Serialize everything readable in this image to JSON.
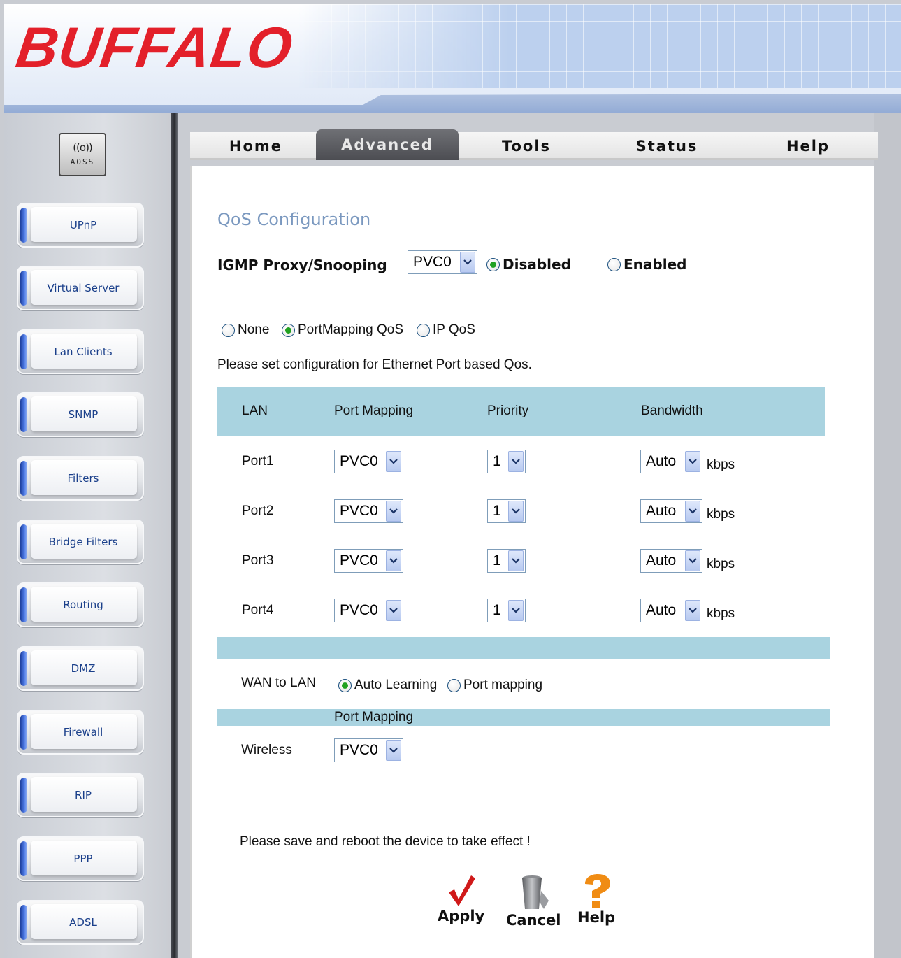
{
  "brand": {
    "logo_text": "BUFFALO",
    "logo_color": "#e3202a",
    "aoss_label": "AOSS"
  },
  "tabs": [
    {
      "label": "Home",
      "active": false
    },
    {
      "label": "Advanced",
      "active": true
    },
    {
      "label": "Tools",
      "active": false
    },
    {
      "label": "Status",
      "active": false
    },
    {
      "label": "Help",
      "active": false
    }
  ],
  "sidebar": {
    "items": [
      {
        "label": "UPnP"
      },
      {
        "label": "Virtual Server"
      },
      {
        "label": "Lan Clients"
      },
      {
        "label": "SNMP"
      },
      {
        "label": "Filters"
      },
      {
        "label": "Bridge Filters"
      },
      {
        "label": "Routing"
      },
      {
        "label": "DMZ"
      },
      {
        "label": "Firewall"
      },
      {
        "label": "RIP"
      },
      {
        "label": "PPP"
      },
      {
        "label": "ADSL"
      }
    ]
  },
  "main": {
    "title": "QoS Configuration",
    "igmp": {
      "label": "IGMP Proxy/Snooping",
      "pvc": "PVC0",
      "options": [
        {
          "label": "Disabled",
          "checked": true
        },
        {
          "label": "Enabled",
          "checked": false
        }
      ]
    },
    "qos_mode": [
      {
        "label": "None",
        "checked": false
      },
      {
        "label": "PortMapping QoS",
        "checked": true
      },
      {
        "label": "IP QoS",
        "checked": false
      }
    ],
    "instruction": "Please set configuration for Ethernet Port based Qos.",
    "table": {
      "headers": [
        "LAN",
        "Port Mapping",
        "Priority",
        "Bandwidth"
      ],
      "unit": "kbps",
      "rows": [
        {
          "port": "Port1",
          "mapping": "PVC0",
          "priority": "1",
          "bandwidth": "Auto"
        },
        {
          "port": "Port2",
          "mapping": "PVC0",
          "priority": "1",
          "bandwidth": "Auto"
        },
        {
          "port": "Port3",
          "mapping": "PVC0",
          "priority": "1",
          "bandwidth": "Auto"
        },
        {
          "port": "Port4",
          "mapping": "PVC0",
          "priority": "1",
          "bandwidth": "Auto"
        }
      ]
    },
    "wan_to_lan": {
      "label": "WAN to LAN",
      "options": [
        {
          "label": "Auto Learning",
          "checked": true
        },
        {
          "label": "Port mapping",
          "checked": false
        }
      ]
    },
    "wireless": {
      "section_header": "Port Mapping",
      "label": "Wireless",
      "mapping": "PVC0"
    },
    "reboot_note": "Please save and reboot the device to take effect !",
    "actions": [
      {
        "label": "Apply"
      },
      {
        "label": "Cancel"
      },
      {
        "label": "Help"
      }
    ]
  },
  "colors": {
    "accent_band": "#a9d3e0",
    "title": "#7a98bf",
    "radio_on": "#21a121",
    "apply_check": "#d01919",
    "help_question": "#f08c14"
  }
}
